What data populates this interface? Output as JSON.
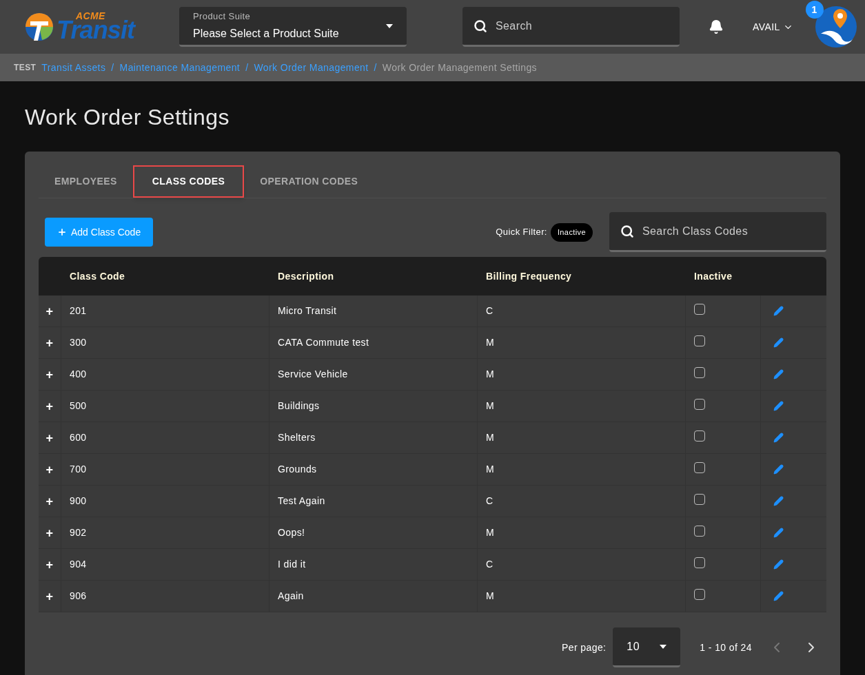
{
  "header": {
    "logo": {
      "small": "ACME",
      "large": "Transit"
    },
    "product_suite": {
      "label": "Product Suite",
      "value": "Please Select a Product Suite"
    },
    "search": {
      "placeholder": "Search"
    },
    "user": "AVAIL",
    "notification_count": "1"
  },
  "breadcrumb": {
    "prefix": "TEST",
    "items": [
      {
        "label": "Transit Assets",
        "link": true
      },
      {
        "label": "Maintenance Management",
        "link": true
      },
      {
        "label": "Work Order Management",
        "link": true
      },
      {
        "label": "Work Order Management Settings",
        "link": false
      }
    ],
    "separator": "/"
  },
  "page_title": "Work Order Settings",
  "tabs": [
    {
      "label": "EMPLOYEES",
      "selected": false
    },
    {
      "label": "CLASS CODES",
      "selected": true
    },
    {
      "label": "OPERATION CODES",
      "selected": false
    }
  ],
  "toolbar": {
    "add_button": "Add Class Code",
    "quick_filter_label": "Quick Filter:",
    "quick_filter_chip": "Inactive",
    "search": {
      "placeholder": "Search Class Codes"
    }
  },
  "table": {
    "columns": [
      "Class Code",
      "Description",
      "Billing Frequency",
      "Inactive"
    ],
    "expand_glyph": "+",
    "rows": [
      {
        "class_code": "201",
        "description": "Micro Transit",
        "billing_frequency": "C",
        "inactive": false
      },
      {
        "class_code": "300",
        "description": "CATA Commute test",
        "billing_frequency": "M",
        "inactive": false
      },
      {
        "class_code": "400",
        "description": "Service Vehicle",
        "billing_frequency": "M",
        "inactive": false
      },
      {
        "class_code": "500",
        "description": "Buildings",
        "billing_frequency": "M",
        "inactive": false
      },
      {
        "class_code": "600",
        "description": "Shelters",
        "billing_frequency": "M",
        "inactive": false
      },
      {
        "class_code": "700",
        "description": "Grounds",
        "billing_frequency": "M",
        "inactive": false
      },
      {
        "class_code": "900",
        "description": "Test Again",
        "billing_frequency": "C",
        "inactive": false
      },
      {
        "class_code": "902",
        "description": "Oops!",
        "billing_frequency": "M",
        "inactive": false
      },
      {
        "class_code": "904",
        "description": "I did it",
        "billing_frequency": "C",
        "inactive": false
      },
      {
        "class_code": "906",
        "description": "Again",
        "billing_frequency": "M",
        "inactive": false
      }
    ]
  },
  "pagination": {
    "per_page_label": "Per page:",
    "per_page": "10",
    "range": "1 - 10 of 24",
    "prev_disabled": true,
    "next_disabled": false
  }
}
